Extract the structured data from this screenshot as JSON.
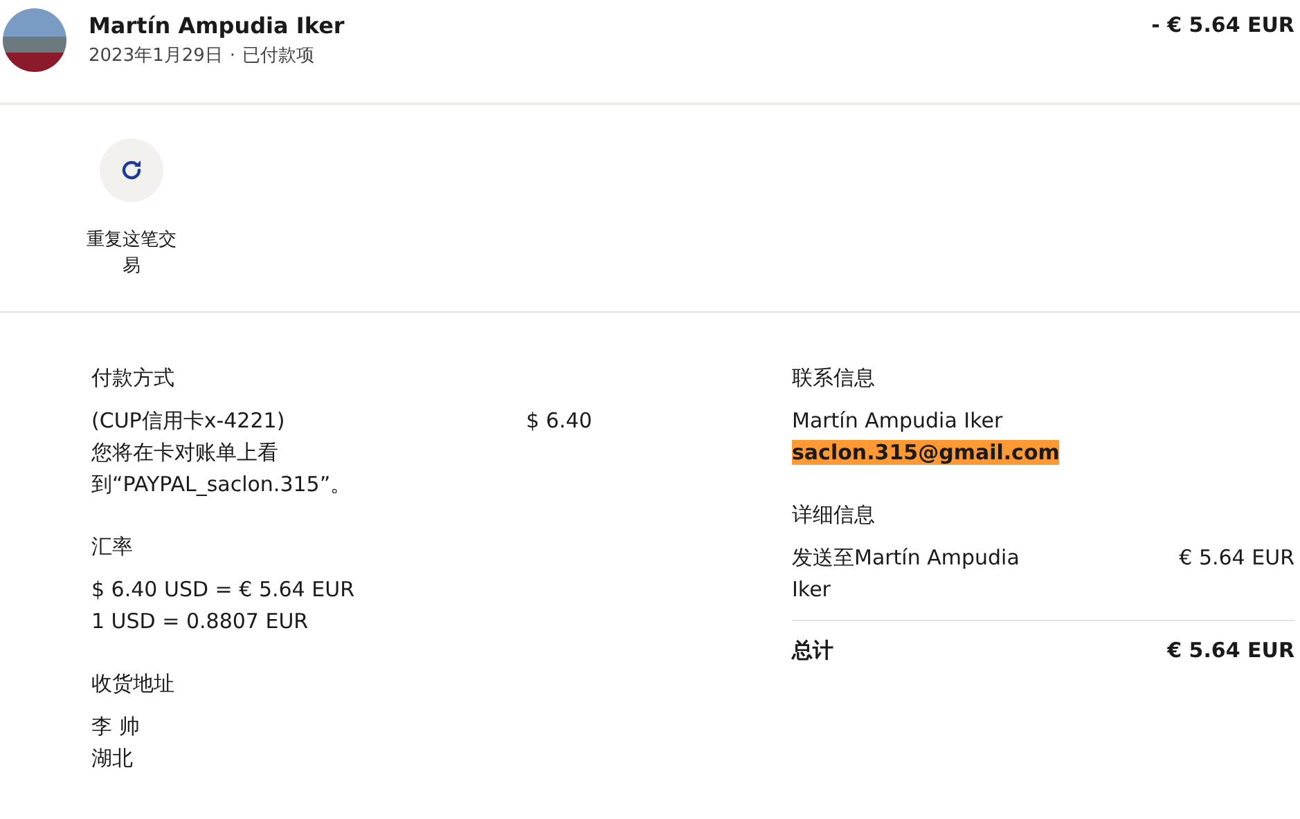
{
  "header": {
    "name": "Martín Ampudia Iker",
    "date": "2023年1月29日",
    "separator": "·",
    "status": "已付款项",
    "amount": "- € 5.64 EUR"
  },
  "actions": [
    {
      "label": "重复这笔交易"
    }
  ],
  "payment": {
    "title": "付款方式",
    "card": "(CUP信用卡x-4221)",
    "amount": "$ 6.40",
    "note": "您将在卡对账单上看到“PAYPAL_saclon.315”。"
  },
  "exchange": {
    "title": "汇率",
    "lines": [
      "$ 6.40 USD = € 5.64 EUR",
      "1 USD = 0.8807 EUR"
    ]
  },
  "shipping": {
    "title": "收货地址",
    "lines": [
      "李 帅",
      "湖北"
    ]
  },
  "contact": {
    "title": "联系信息",
    "name": "Martín Ampudia Iker",
    "email": "saclon.315@gmail.com",
    "email_highlighted": true
  },
  "details": {
    "title": "详细信息",
    "items": [
      {
        "label": "发送至Martín Ampudia Iker",
        "amount": "€ 5.64 EUR"
      }
    ],
    "total_label": "总计",
    "total_amount": "€ 5.64 EUR"
  }
}
